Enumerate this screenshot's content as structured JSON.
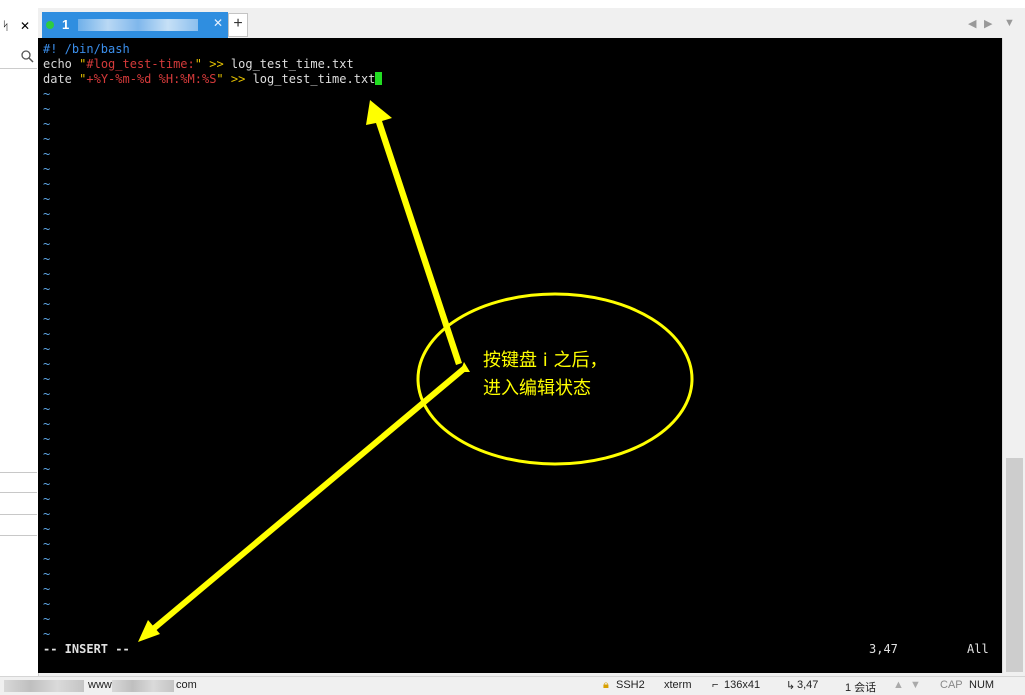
{
  "tab": {
    "title": "1",
    "close_icon": "close-icon",
    "add_label": "+"
  },
  "left_panel": {
    "pin_icon": "pin-icon",
    "close_label": "✕",
    "search_icon": "search-icon"
  },
  "terminal": {
    "shebang": "#! /bin/bash",
    "line2": {
      "cmd": "echo",
      "quote_open": "\"",
      "string": "#log_test-time:",
      "quote_close": "\"",
      "redir": ">>",
      "file": "log_test_time.txt"
    },
    "line3": {
      "cmd": "date",
      "quote_open": "\"",
      "string": "+%Y-%m-%d %H:%M:%S",
      "quote_close": "\"",
      "redir": ">>",
      "file": "log_test_time.txt"
    },
    "tilde": "~",
    "mode": "-- INSERT --",
    "position": "3,47",
    "scroll": "All"
  },
  "annotation": {
    "line1": "按键盘 i 之后，",
    "line2": "进入编辑状态",
    "color": "#ffff00"
  },
  "statusbar": {
    "url_prefix": "www.",
    "url_suffix": "com",
    "protocol": "SSH2",
    "term": "xterm",
    "size": "136x41",
    "cursor_pos": "3,47",
    "sessions": "1 会话",
    "cap": "CAP",
    "num": "NUM"
  }
}
